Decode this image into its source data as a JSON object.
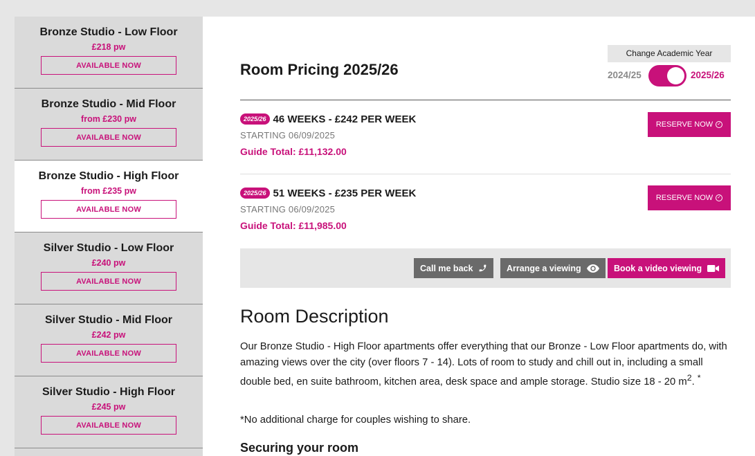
{
  "sidebar": {
    "items": [
      {
        "name": "Bronze Studio - Low Floor",
        "price": "£218 pw",
        "button": "AVAILABLE NOW"
      },
      {
        "name": "Bronze Studio - Mid Floor",
        "price": "from £230 pw",
        "button": "AVAILABLE NOW"
      },
      {
        "name": "Bronze Studio - High Floor",
        "price": "from £235 pw",
        "button": "AVAILABLE NOW"
      },
      {
        "name": "Silver Studio - Low Floor",
        "price": "£240 pw",
        "button": "AVAILABLE NOW"
      },
      {
        "name": "Silver Studio - Mid Floor",
        "price": "£242 pw",
        "button": "AVAILABLE NOW"
      },
      {
        "name": "Silver Studio - High Floor",
        "price": "£245 pw",
        "button": "AVAILABLE NOW"
      }
    ],
    "active_index": 2
  },
  "pricing": {
    "title": "Room Pricing 2025/26",
    "change_year_label": "Change Academic Year",
    "year_old": "2024/25",
    "year_new": "2025/26",
    "options": [
      {
        "badge": "2025/26",
        "title": "46 WEEKS - £242 PER WEEK",
        "start": "STARTING 06/09/2025",
        "total": "Guide Total: £11,132.00",
        "button": "RESERVE NOW"
      },
      {
        "badge": "2025/26",
        "title": "51 WEEKS - £235 PER WEEK",
        "start": "STARTING 06/09/2025",
        "total": "Guide Total: £11,985.00",
        "button": "RESERVE NOW"
      }
    ]
  },
  "actions": {
    "call_back": "Call me back",
    "arrange_viewing": "Arrange a viewing",
    "video_viewing": "Book a video viewing"
  },
  "description": {
    "title": "Room Description",
    "text": "Our Bronze Studio - High Floor apartments offer everything that our Bronze - Low Floor apartments do, with amazing views over the city (over floors 7 - 14). Lots of room to study and chill out in, including a small double bed, en suite bathroom, kitchen area, desk space and ample storage. Studio size 18 - 20 m",
    "text_sup": "2",
    "text_end": ". ",
    "text_star": "*",
    "note": "*No additional charge for couples wishing to share.",
    "secure_title": "Securing your room"
  },
  "colors": {
    "accent": "#c8117a",
    "grey_button": "#6a6a6a",
    "sidebar_bg": "#dadada"
  }
}
